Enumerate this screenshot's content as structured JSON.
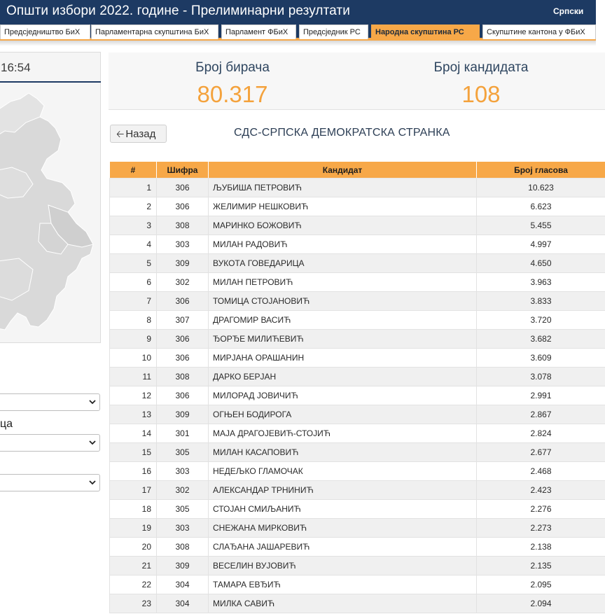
{
  "header": {
    "title": "Општи избори 2022. године - Прелиминарни резултати",
    "language": "Српски",
    "tabs": [
      {
        "label": "Предсједништво БиХ",
        "active": false
      },
      {
        "label": "Парламентарна скупштина БиХ",
        "active": false
      },
      {
        "label": "Парламент ФБиХ",
        "active": false
      },
      {
        "label": "Предсједник РС",
        "active": false
      },
      {
        "label": "Народна скупштина РС",
        "active": true
      },
      {
        "label": "Скупштине кантона у ФБиХ",
        "active": false
      }
    ]
  },
  "sidebar": {
    "time": "16:54",
    "partial_label": "ца"
  },
  "stats": {
    "voters_label": "Број бирача",
    "voters_value": "80.317",
    "candidates_label": "Број кандидата",
    "candidates_value": "108"
  },
  "back_label": "Назад",
  "party_name": "СДС-СРПСКА ДЕМОКРАТСКА СТРАНКА",
  "table": {
    "headers": [
      "#",
      "Шифра",
      "Кандидат",
      "Број гласова"
    ],
    "rows": [
      {
        "num": "1",
        "code": "306",
        "name": "ЉУБИША ПЕТРОВИЋ",
        "votes": "10.623"
      },
      {
        "num": "2",
        "code": "306",
        "name": "ЖЕЛИМИР НЕШКОВИЋ",
        "votes": "6.623"
      },
      {
        "num": "3",
        "code": "308",
        "name": "МАРИНКО БОЖОВИЋ",
        "votes": "5.455"
      },
      {
        "num": "4",
        "code": "303",
        "name": "МИЛАН РАДОВИЋ",
        "votes": "4.997"
      },
      {
        "num": "5",
        "code": "309",
        "name": "ВУКОТА ГОВЕДАРИЦА",
        "votes": "4.650"
      },
      {
        "num": "6",
        "code": "302",
        "name": "МИЛАН ПЕТРОВИЋ",
        "votes": "3.963"
      },
      {
        "num": "7",
        "code": "306",
        "name": "ТОМИЦА СТОЈАНОВИЋ",
        "votes": "3.833"
      },
      {
        "num": "8",
        "code": "307",
        "name": "ДРАГОМИР ВАСИЋ",
        "votes": "3.720"
      },
      {
        "num": "9",
        "code": "306",
        "name": "ЂОРЂЕ МИЛИЋЕВИЋ",
        "votes": "3.682"
      },
      {
        "num": "10",
        "code": "306",
        "name": "МИРЈАНА ОРАШАНИН",
        "votes": "3.609"
      },
      {
        "num": "11",
        "code": "308",
        "name": "ДАРКО БЕРЈАН",
        "votes": "3.078"
      },
      {
        "num": "12",
        "code": "306",
        "name": "МИЛОРАД ЈОВИЧИЋ",
        "votes": "2.991"
      },
      {
        "num": "13",
        "code": "309",
        "name": "ОГЊЕН БОДИРОГА",
        "votes": "2.867"
      },
      {
        "num": "14",
        "code": "301",
        "name": "МАЈА ДРАГОЈЕВИЋ-СТОЈИЋ",
        "votes": "2.824"
      },
      {
        "num": "15",
        "code": "305",
        "name": "МИЛАН КАСАПОВИЋ",
        "votes": "2.677"
      },
      {
        "num": "16",
        "code": "303",
        "name": "НЕДЕЉКО ГЛАМОЧАК",
        "votes": "2.468"
      },
      {
        "num": "17",
        "code": "302",
        "name": "АЛЕКСАНДАР ТРНИНИЋ",
        "votes": "2.423"
      },
      {
        "num": "18",
        "code": "305",
        "name": "СТОЈАН СМИЉАНИЋ",
        "votes": "2.276"
      },
      {
        "num": "19",
        "code": "303",
        "name": "СНЕЖАНА МИРКОВИЋ",
        "votes": "2.273"
      },
      {
        "num": "20",
        "code": "308",
        "name": "СЛАЂАНА ЈАШАРЕВИЋ",
        "votes": "2.138"
      },
      {
        "num": "21",
        "code": "309",
        "name": "ВЕСЕЛИН ВУЈОВИЋ",
        "votes": "2.135"
      },
      {
        "num": "22",
        "code": "304",
        "name": "ТАМАРА ЕВЂИЋ",
        "votes": "2.095"
      },
      {
        "num": "23",
        "code": "304",
        "name": "МИЛКА САВИЋ",
        "votes": "2.094"
      }
    ]
  }
}
